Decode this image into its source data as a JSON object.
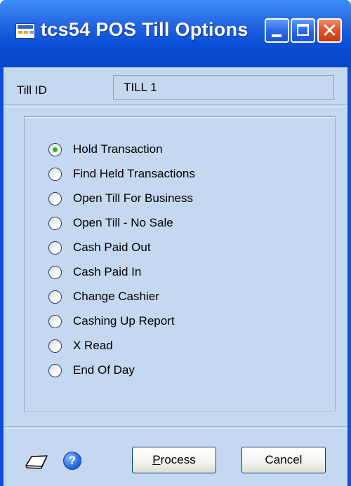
{
  "window": {
    "title": "tcs54 POS Till Options",
    "controls": {
      "minimize": "minimize",
      "maximize": "maximize",
      "close": "✕"
    }
  },
  "till": {
    "label": "Till ID",
    "value": "TILL 1"
  },
  "options": [
    {
      "label": "Hold Transaction",
      "checked": true
    },
    {
      "label": "Find Held Transactions",
      "checked": false
    },
    {
      "label": "Open Till For Business",
      "checked": false
    },
    {
      "label": "Open Till - No Sale",
      "checked": false
    },
    {
      "label": "Cash Paid Out",
      "checked": false
    },
    {
      "label": "Cash Paid In",
      "checked": false
    },
    {
      "label": "Change Cashier",
      "checked": false
    },
    {
      "label": "Cashing Up Report",
      "checked": false
    },
    {
      "label": "X Read",
      "checked": false
    },
    {
      "label": "End Of Day",
      "checked": false
    }
  ],
  "footer": {
    "note_icon": "note-icon",
    "help_icon": "help-icon",
    "help_glyph": "?",
    "process_mnemonic": "P",
    "process_rest": "rocess",
    "cancel_label": "Cancel"
  },
  "colors": {
    "titlebar": "#0b4fd6",
    "client_background": "#c4d8ef",
    "radio_selected": "#27b42a",
    "close_button": "#e0502a"
  }
}
